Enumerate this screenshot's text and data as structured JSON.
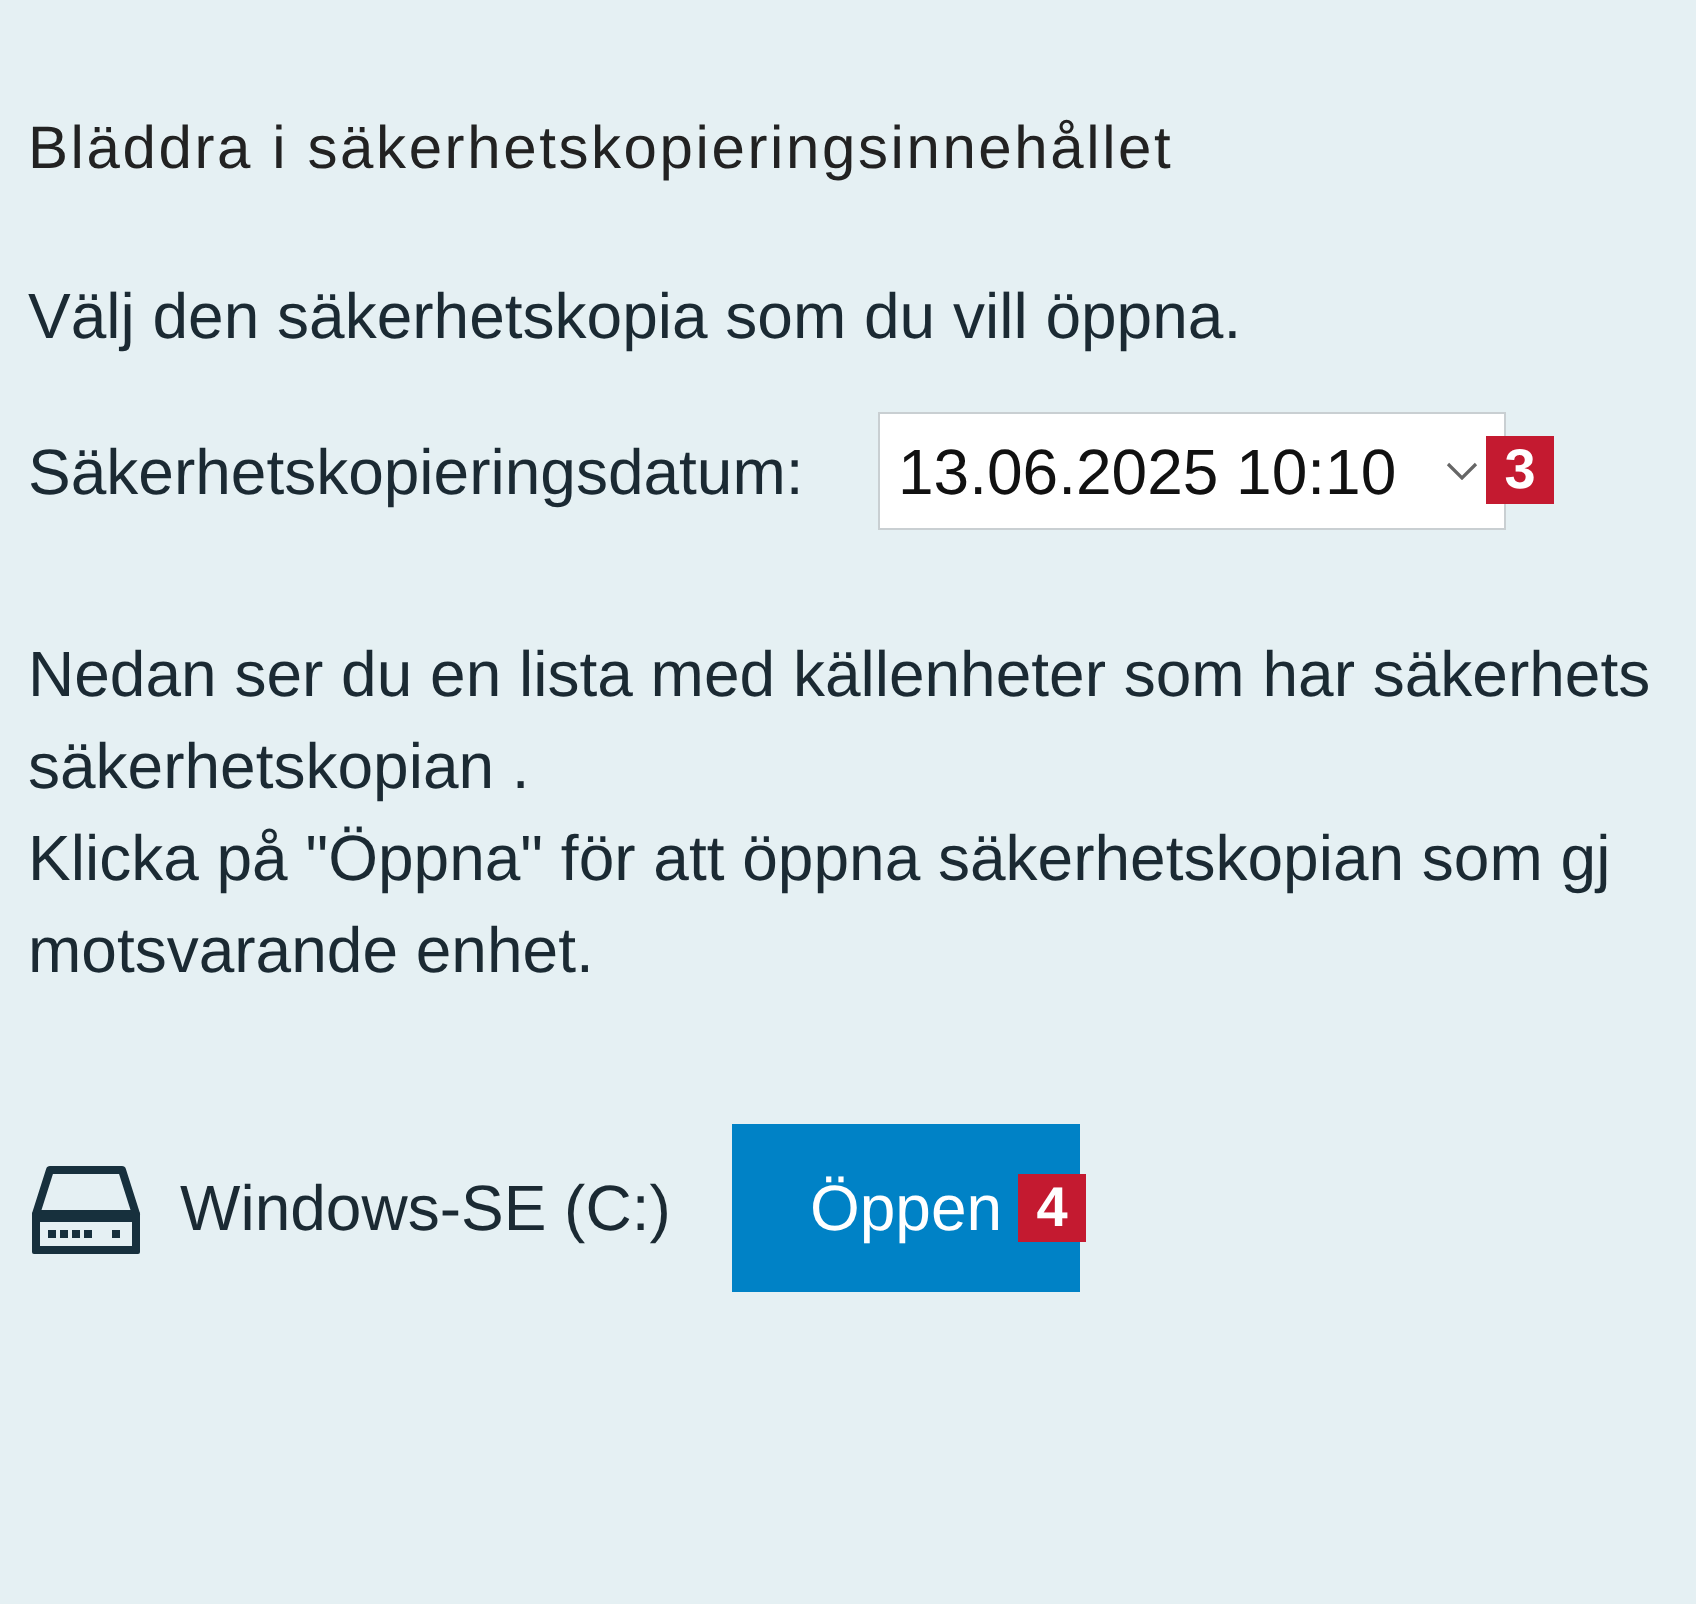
{
  "dialog": {
    "title": "Bläddra i säkerhetskopieringsinnehållet",
    "instruction": "Välj den säkerhetskopia som du vill öppna.",
    "date_field": {
      "label": "Säkerhetskopieringsdatum:",
      "value": "13.06.2025 10:10",
      "callout": "3"
    },
    "description_lines": [
      "Nedan ser du en lista med källenheter som har säkerhets",
      "säkerhetskopian .",
      "Klicka på \"Öppna\" för att öppna säkerhetskopian som gj",
      "motsvarande enhet."
    ],
    "devices": [
      {
        "name": "Windows-SE (C:)",
        "button": "Öppen",
        "callout": "4"
      }
    ]
  }
}
